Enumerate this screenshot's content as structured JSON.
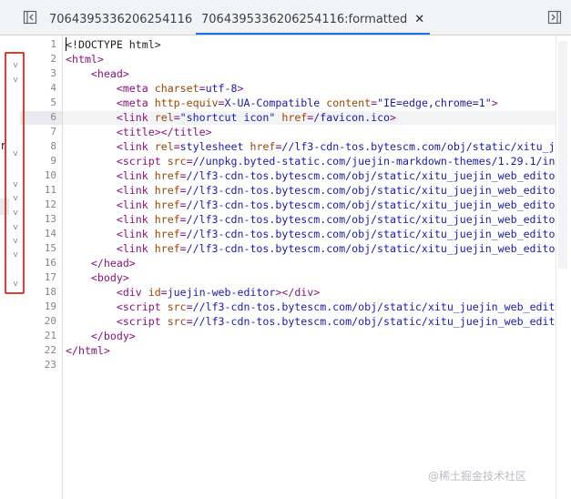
{
  "tabs": [
    {
      "label": "7064395336206254116",
      "active": false
    },
    {
      "label": "7064395336206254116:formatted",
      "active": true,
      "close_glyph": "✕"
    }
  ],
  "toolbar": {
    "left_icon": "sidebar-toggle-icon",
    "right_icon": "sidebar-toggle-right-icon"
  },
  "gutter_clipped_text": [
    "r"
  ],
  "fold_markers": [
    "v",
    "v",
    "v",
    "v",
    "v",
    "v",
    "v",
    "v",
    "v",
    "v"
  ],
  "line_numbers": [
    "1",
    "2",
    "3",
    "4",
    "5",
    "6",
    "7",
    "8",
    "9",
    "10",
    "11",
    "12",
    "13",
    "14",
    "15",
    "16",
    "17",
    "18",
    "19",
    "20",
    "21",
    "22",
    "23"
  ],
  "code_lines": [
    [
      {
        "c": "dt",
        "t": "<!DOCTYPE html>"
      }
    ],
    [
      {
        "c": "t",
        "t": "<html>"
      }
    ],
    [
      {
        "c": "",
        "t": "    "
      },
      {
        "c": "t",
        "t": "<head>"
      }
    ],
    [
      {
        "c": "",
        "t": "        "
      },
      {
        "c": "t",
        "t": "<meta "
      },
      {
        "c": "a",
        "t": "charset"
      },
      {
        "c": "t",
        "t": "="
      },
      {
        "c": "v",
        "t": "utf-8"
      },
      {
        "c": "t",
        "t": ">"
      }
    ],
    [
      {
        "c": "",
        "t": "        "
      },
      {
        "c": "t",
        "t": "<meta "
      },
      {
        "c": "a",
        "t": "http-equiv"
      },
      {
        "c": "t",
        "t": "="
      },
      {
        "c": "v",
        "t": "X-UA-Compatible"
      },
      {
        "c": "t",
        "t": " "
      },
      {
        "c": "a",
        "t": "content"
      },
      {
        "c": "t",
        "t": "="
      },
      {
        "c": "v",
        "t": "\"IE=edge,chrome=1\""
      },
      {
        "c": "t",
        "t": ">"
      }
    ],
    [
      {
        "c": "",
        "t": "        "
      },
      {
        "c": "t",
        "t": "<link "
      },
      {
        "c": "a",
        "t": "rel"
      },
      {
        "c": "t",
        "t": "="
      },
      {
        "c": "v",
        "t": "\"shortcut icon\""
      },
      {
        "c": "t",
        "t": " "
      },
      {
        "c": "a",
        "t": "href"
      },
      {
        "c": "t",
        "t": "="
      },
      {
        "c": "v",
        "t": "/favicon.ico"
      },
      {
        "c": "t",
        "t": ">"
      }
    ],
    [
      {
        "c": "",
        "t": "        "
      },
      {
        "c": "t",
        "t": "<title></title>"
      }
    ],
    [
      {
        "c": "",
        "t": "        "
      },
      {
        "c": "t",
        "t": "<link "
      },
      {
        "c": "a",
        "t": "rel"
      },
      {
        "c": "t",
        "t": "="
      },
      {
        "c": "v",
        "t": "stylesheet"
      },
      {
        "c": "t",
        "t": " "
      },
      {
        "c": "a",
        "t": "href"
      },
      {
        "c": "t",
        "t": "="
      },
      {
        "c": "v",
        "t": "//lf3-cdn-tos.bytescm.com/obj/static/xitu_juejin_web_editor"
      }
    ],
    [
      {
        "c": "",
        "t": "        "
      },
      {
        "c": "t",
        "t": "<script "
      },
      {
        "c": "a",
        "t": "src"
      },
      {
        "c": "t",
        "t": "="
      },
      {
        "c": "v",
        "t": "//unpkg.byted-static.com/juejin-markdown-themes/1.29.1/index.js"
      }
    ],
    [
      {
        "c": "",
        "t": "        "
      },
      {
        "c": "t",
        "t": "<link "
      },
      {
        "c": "a",
        "t": "href"
      },
      {
        "c": "t",
        "t": "="
      },
      {
        "c": "v",
        "t": "//lf3-cdn-tos.bytescm.com/obj/static/xitu_juejin_web_editor/"
      }
    ],
    [
      {
        "c": "",
        "t": "        "
      },
      {
        "c": "t",
        "t": "<link "
      },
      {
        "c": "a",
        "t": "href"
      },
      {
        "c": "t",
        "t": "="
      },
      {
        "c": "v",
        "t": "//lf3-cdn-tos.bytescm.com/obj/static/xitu_juejin_web_editor/"
      }
    ],
    [
      {
        "c": "",
        "t": "        "
      },
      {
        "c": "t",
        "t": "<link "
      },
      {
        "c": "a",
        "t": "href"
      },
      {
        "c": "t",
        "t": "="
      },
      {
        "c": "v",
        "t": "//lf3-cdn-tos.bytescm.com/obj/static/xitu_juejin_web_editor/"
      }
    ],
    [
      {
        "c": "",
        "t": "        "
      },
      {
        "c": "t",
        "t": "<link "
      },
      {
        "c": "a",
        "t": "href"
      },
      {
        "c": "t",
        "t": "="
      },
      {
        "c": "v",
        "t": "//lf3-cdn-tos.bytescm.com/obj/static/xitu_juejin_web_editor/"
      }
    ],
    [
      {
        "c": "",
        "t": "        "
      },
      {
        "c": "t",
        "t": "<link "
      },
      {
        "c": "a",
        "t": "href"
      },
      {
        "c": "t",
        "t": "="
      },
      {
        "c": "v",
        "t": "//lf3-cdn-tos.bytescm.com/obj/static/xitu_juejin_web_editor/"
      }
    ],
    [
      {
        "c": "",
        "t": "        "
      },
      {
        "c": "t",
        "t": "<link "
      },
      {
        "c": "a",
        "t": "href"
      },
      {
        "c": "t",
        "t": "="
      },
      {
        "c": "v",
        "t": "//lf3-cdn-tos.bytescm.com/obj/static/xitu_juejin_web_editor/"
      }
    ],
    [
      {
        "c": "",
        "t": "    "
      },
      {
        "c": "t",
        "t": "</head>"
      }
    ],
    [
      {
        "c": "",
        "t": "    "
      },
      {
        "c": "t",
        "t": "<body>"
      }
    ],
    [
      {
        "c": "",
        "t": "        "
      },
      {
        "c": "t",
        "t": "<div "
      },
      {
        "c": "a",
        "t": "id"
      },
      {
        "c": "t",
        "t": "="
      },
      {
        "c": "v",
        "t": "juejin-web-editor"
      },
      {
        "c": "t",
        "t": "></div>"
      }
    ],
    [
      {
        "c": "",
        "t": "        "
      },
      {
        "c": "t",
        "t": "<script "
      },
      {
        "c": "a",
        "t": "src"
      },
      {
        "c": "t",
        "t": "="
      },
      {
        "c": "v",
        "t": "//lf3-cdn-tos.bytescm.com/obj/static/xitu_juejin_web_editor/"
      }
    ],
    [
      {
        "c": "",
        "t": "        "
      },
      {
        "c": "t",
        "t": "<script "
      },
      {
        "c": "a",
        "t": "src"
      },
      {
        "c": "t",
        "t": "="
      },
      {
        "c": "v",
        "t": "//lf3-cdn-tos.bytescm.com/obj/static/xitu_juejin_web_editor/"
      }
    ],
    [
      {
        "c": "",
        "t": "    "
      },
      {
        "c": "t",
        "t": "</body>"
      }
    ],
    [
      {
        "c": "t",
        "t": "</html>"
      }
    ],
    []
  ],
  "watermark": "@稀土掘金技术社区",
  "colors": {
    "tag": "#881280",
    "attribute": "#994500",
    "value": "#1a1aa6",
    "highlight_box": "#e53935",
    "active_tab": "#1a73e8"
  }
}
